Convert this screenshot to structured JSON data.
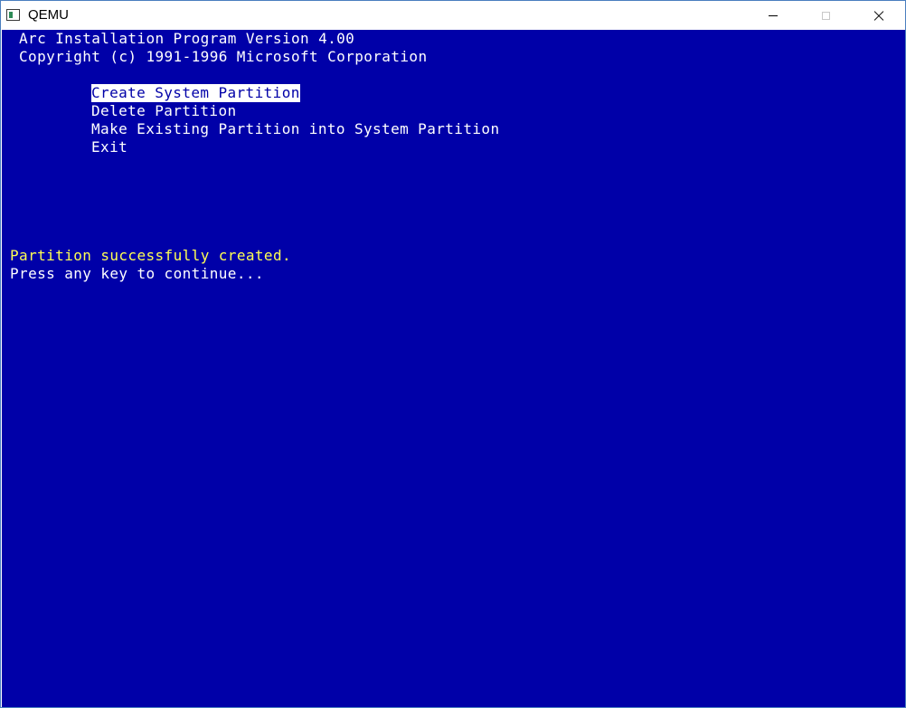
{
  "window": {
    "title": "QEMU",
    "icon": "qemu-app-icon",
    "controls": [
      "minimize-icon",
      "maximize-icon",
      "close-icon"
    ]
  },
  "colors": {
    "screen_background": "#0000a8",
    "text": "#ffffff",
    "highlight_text": "#ffff54",
    "selected_background": "#ffffff",
    "selected_text": "#0000a8"
  },
  "header": {
    "line1": "Arc Installation Program Version 4.00",
    "line2": "Copyright (c) 1991-1996 Microsoft Corporation"
  },
  "menu": {
    "selected_index": 0,
    "items": [
      {
        "label": "Create System Partition"
      },
      {
        "label": "Delete Partition"
      },
      {
        "label": "Make Existing Partition into System Partition"
      },
      {
        "label": "Exit"
      }
    ]
  },
  "status": {
    "message": "Partition successfully created.",
    "prompt": "Press any key to continue..."
  }
}
